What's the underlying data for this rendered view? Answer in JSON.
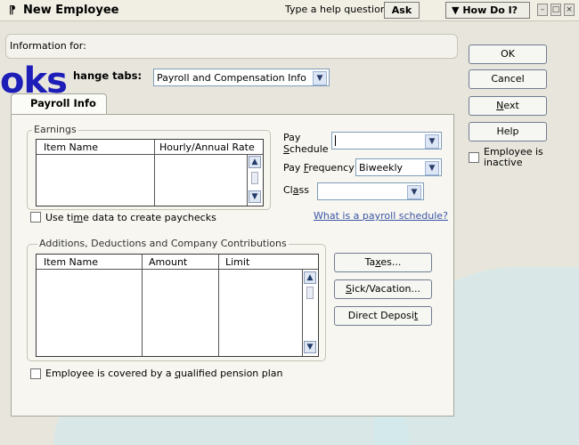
{
  "window": {
    "title": "New Employee",
    "help_placeholder": "Type a help question",
    "ask_label": "Ask",
    "how_do_i_label": "How Do I?"
  },
  "info": {
    "label": "Information for:"
  },
  "change_tabs": {
    "label": "hange tabs:",
    "value": "Payroll and Compensation Info"
  },
  "watermark_logo": "oks",
  "tab": {
    "label": "Payroll Info"
  },
  "earnings": {
    "group_title": "Earnings",
    "columns": [
      "Item Name",
      "Hourly/Annual Rate"
    ]
  },
  "pay_schedule": {
    "label_line1": "Pay",
    "label_line2": "Schedule",
    "value": ""
  },
  "pay_frequency": {
    "label": "Pay Frequency",
    "value": "Biweekly"
  },
  "class_field": {
    "label": "Class",
    "value": ""
  },
  "time_data_checkbox": {
    "label": "Use time data to create paychecks"
  },
  "payroll_schedule_link": "What is a payroll schedule?",
  "additions": {
    "group_title": "Additions, Deductions and Company Contributions",
    "columns": [
      "Item Name",
      "Amount",
      "Limit"
    ]
  },
  "buttons": {
    "taxes": "Taxes...",
    "sick_vacation": "Sick/Vacation...",
    "direct_deposit": "Direct Deposit"
  },
  "pension_checkbox": {
    "label": "Employee is covered by a qualified pension plan"
  },
  "side_buttons": {
    "ok": "OK",
    "cancel": "Cancel",
    "next": "Next",
    "help": "Help"
  },
  "inactive_checkbox": {
    "label_line1": "Employee is",
    "label_line2": "inactive"
  }
}
